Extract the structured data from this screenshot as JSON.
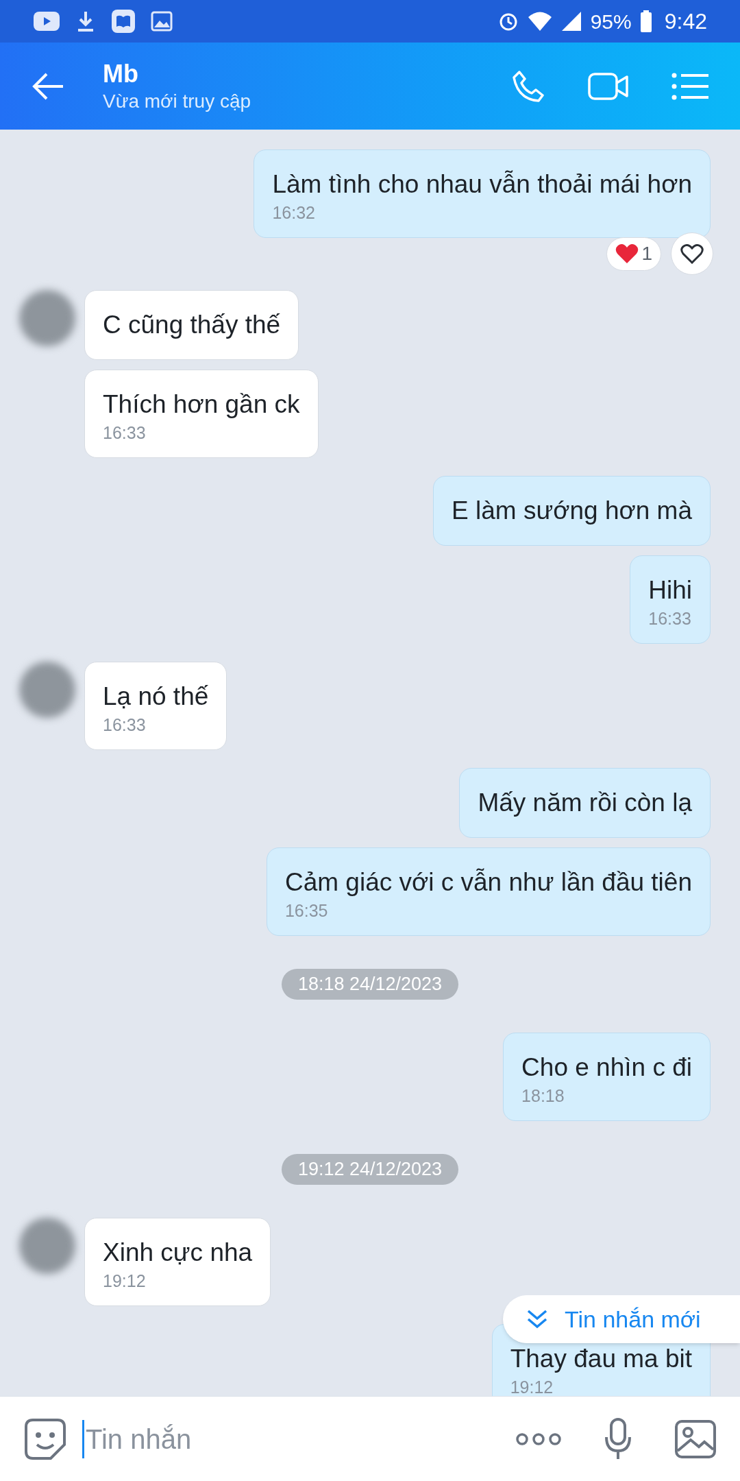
{
  "status_bar": {
    "battery": "95%",
    "time": "9:42"
  },
  "header": {
    "title": "Mb",
    "subtitle": "Vừa mới truy cập"
  },
  "messages": [
    {
      "kind": "message",
      "sent": true,
      "text": "Làm tình cho nhau vẫn thoải mái hơn",
      "time": "16:32",
      "reaction_count": "1"
    },
    {
      "kind": "message",
      "sent": false,
      "text": "C cũng thấy thế",
      "avatar": true
    },
    {
      "kind": "message",
      "sent": false,
      "text": "Thích hơn gần ck",
      "time": "16:33"
    },
    {
      "kind": "message",
      "sent": true,
      "text": "E làm sướng hơn mà"
    },
    {
      "kind": "message",
      "sent": true,
      "text": "Hihi",
      "time": "16:33"
    },
    {
      "kind": "message",
      "sent": false,
      "text": "Lạ nó thế",
      "time": "16:33",
      "avatar": true
    },
    {
      "kind": "message",
      "sent": true,
      "text": "Mấy năm rồi còn lạ"
    },
    {
      "kind": "message",
      "sent": true,
      "text": "Cảm giác với c vẫn như lần đầu tiên",
      "time": "16:35"
    },
    {
      "kind": "date",
      "text": "18:18 24/12/2023"
    },
    {
      "kind": "message",
      "sent": true,
      "text": "Cho e nhìn c đi",
      "time": "18:18"
    },
    {
      "kind": "date",
      "text": "19:12 24/12/2023"
    },
    {
      "kind": "message",
      "sent": false,
      "text": "Xinh cực nha",
      "time": "19:12",
      "avatar": true
    },
    {
      "kind": "message",
      "sent": true,
      "text": "Thay đau ma bit",
      "time": "19:12"
    }
  ],
  "new_messages": {
    "label": "Tin nhắn mới"
  },
  "composer": {
    "placeholder": "Tin nhắn"
  }
}
